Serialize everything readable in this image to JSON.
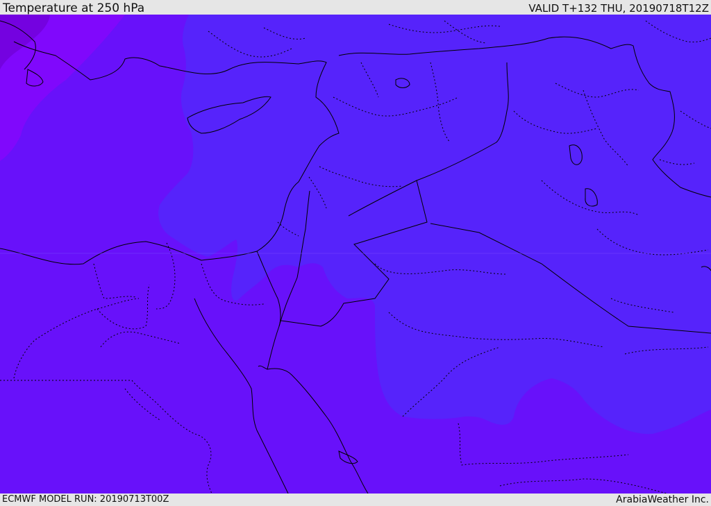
{
  "header": {
    "title": "Temperature at 250 hPa",
    "valid": "VALID T+132 THU, 20190718T12Z"
  },
  "footer": {
    "model_run": "ECMWF MODEL RUN: 20190713T00Z",
    "credit": "ArabiaWeather Inc."
  },
  "colors": {
    "base_fill": "#6811fa",
    "warm_band": "#5623fb",
    "cold_band": "#8008fc",
    "coldest_core": "#7402e0",
    "border_line": "#000000"
  }
}
